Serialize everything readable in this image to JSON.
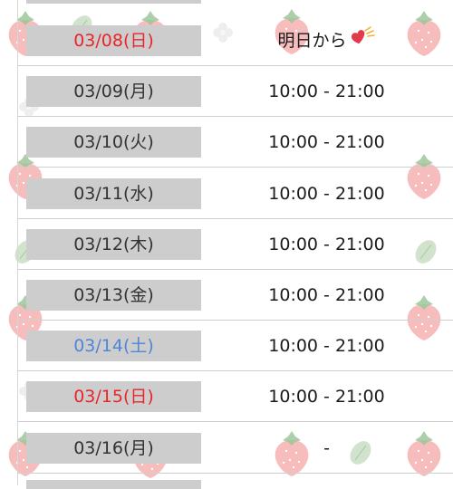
{
  "schedule": [
    {
      "date": "03/08(日)",
      "hours": "明日から",
      "day_type": "sun",
      "icon": "heart-sticker-icon"
    },
    {
      "date": "03/09(月)",
      "hours": "10:00 - 21:00",
      "day_type": "weekday"
    },
    {
      "date": "03/10(火)",
      "hours": "10:00 - 21:00",
      "day_type": "weekday"
    },
    {
      "date": "03/11(水)",
      "hours": "10:00 - 21:00",
      "day_type": "weekday"
    },
    {
      "date": "03/12(木)",
      "hours": "10:00 - 21:00",
      "day_type": "weekday"
    },
    {
      "date": "03/13(金)",
      "hours": "10:00 - 21:00",
      "day_type": "weekday"
    },
    {
      "date": "03/14(土)",
      "hours": "10:00 - 21:00",
      "day_type": "sat"
    },
    {
      "date": "03/15(日)",
      "hours": "10:00 - 21:00",
      "day_type": "sun"
    },
    {
      "date": "03/16(月)",
      "hours": "-",
      "day_type": "weekday"
    }
  ],
  "colors": {
    "sunday": "#e8262a",
    "saturday": "#4f86d8",
    "weekday": "#333333",
    "date_cell_bg": "#cdcdcd",
    "background_decoration": "strawberry-pattern"
  }
}
